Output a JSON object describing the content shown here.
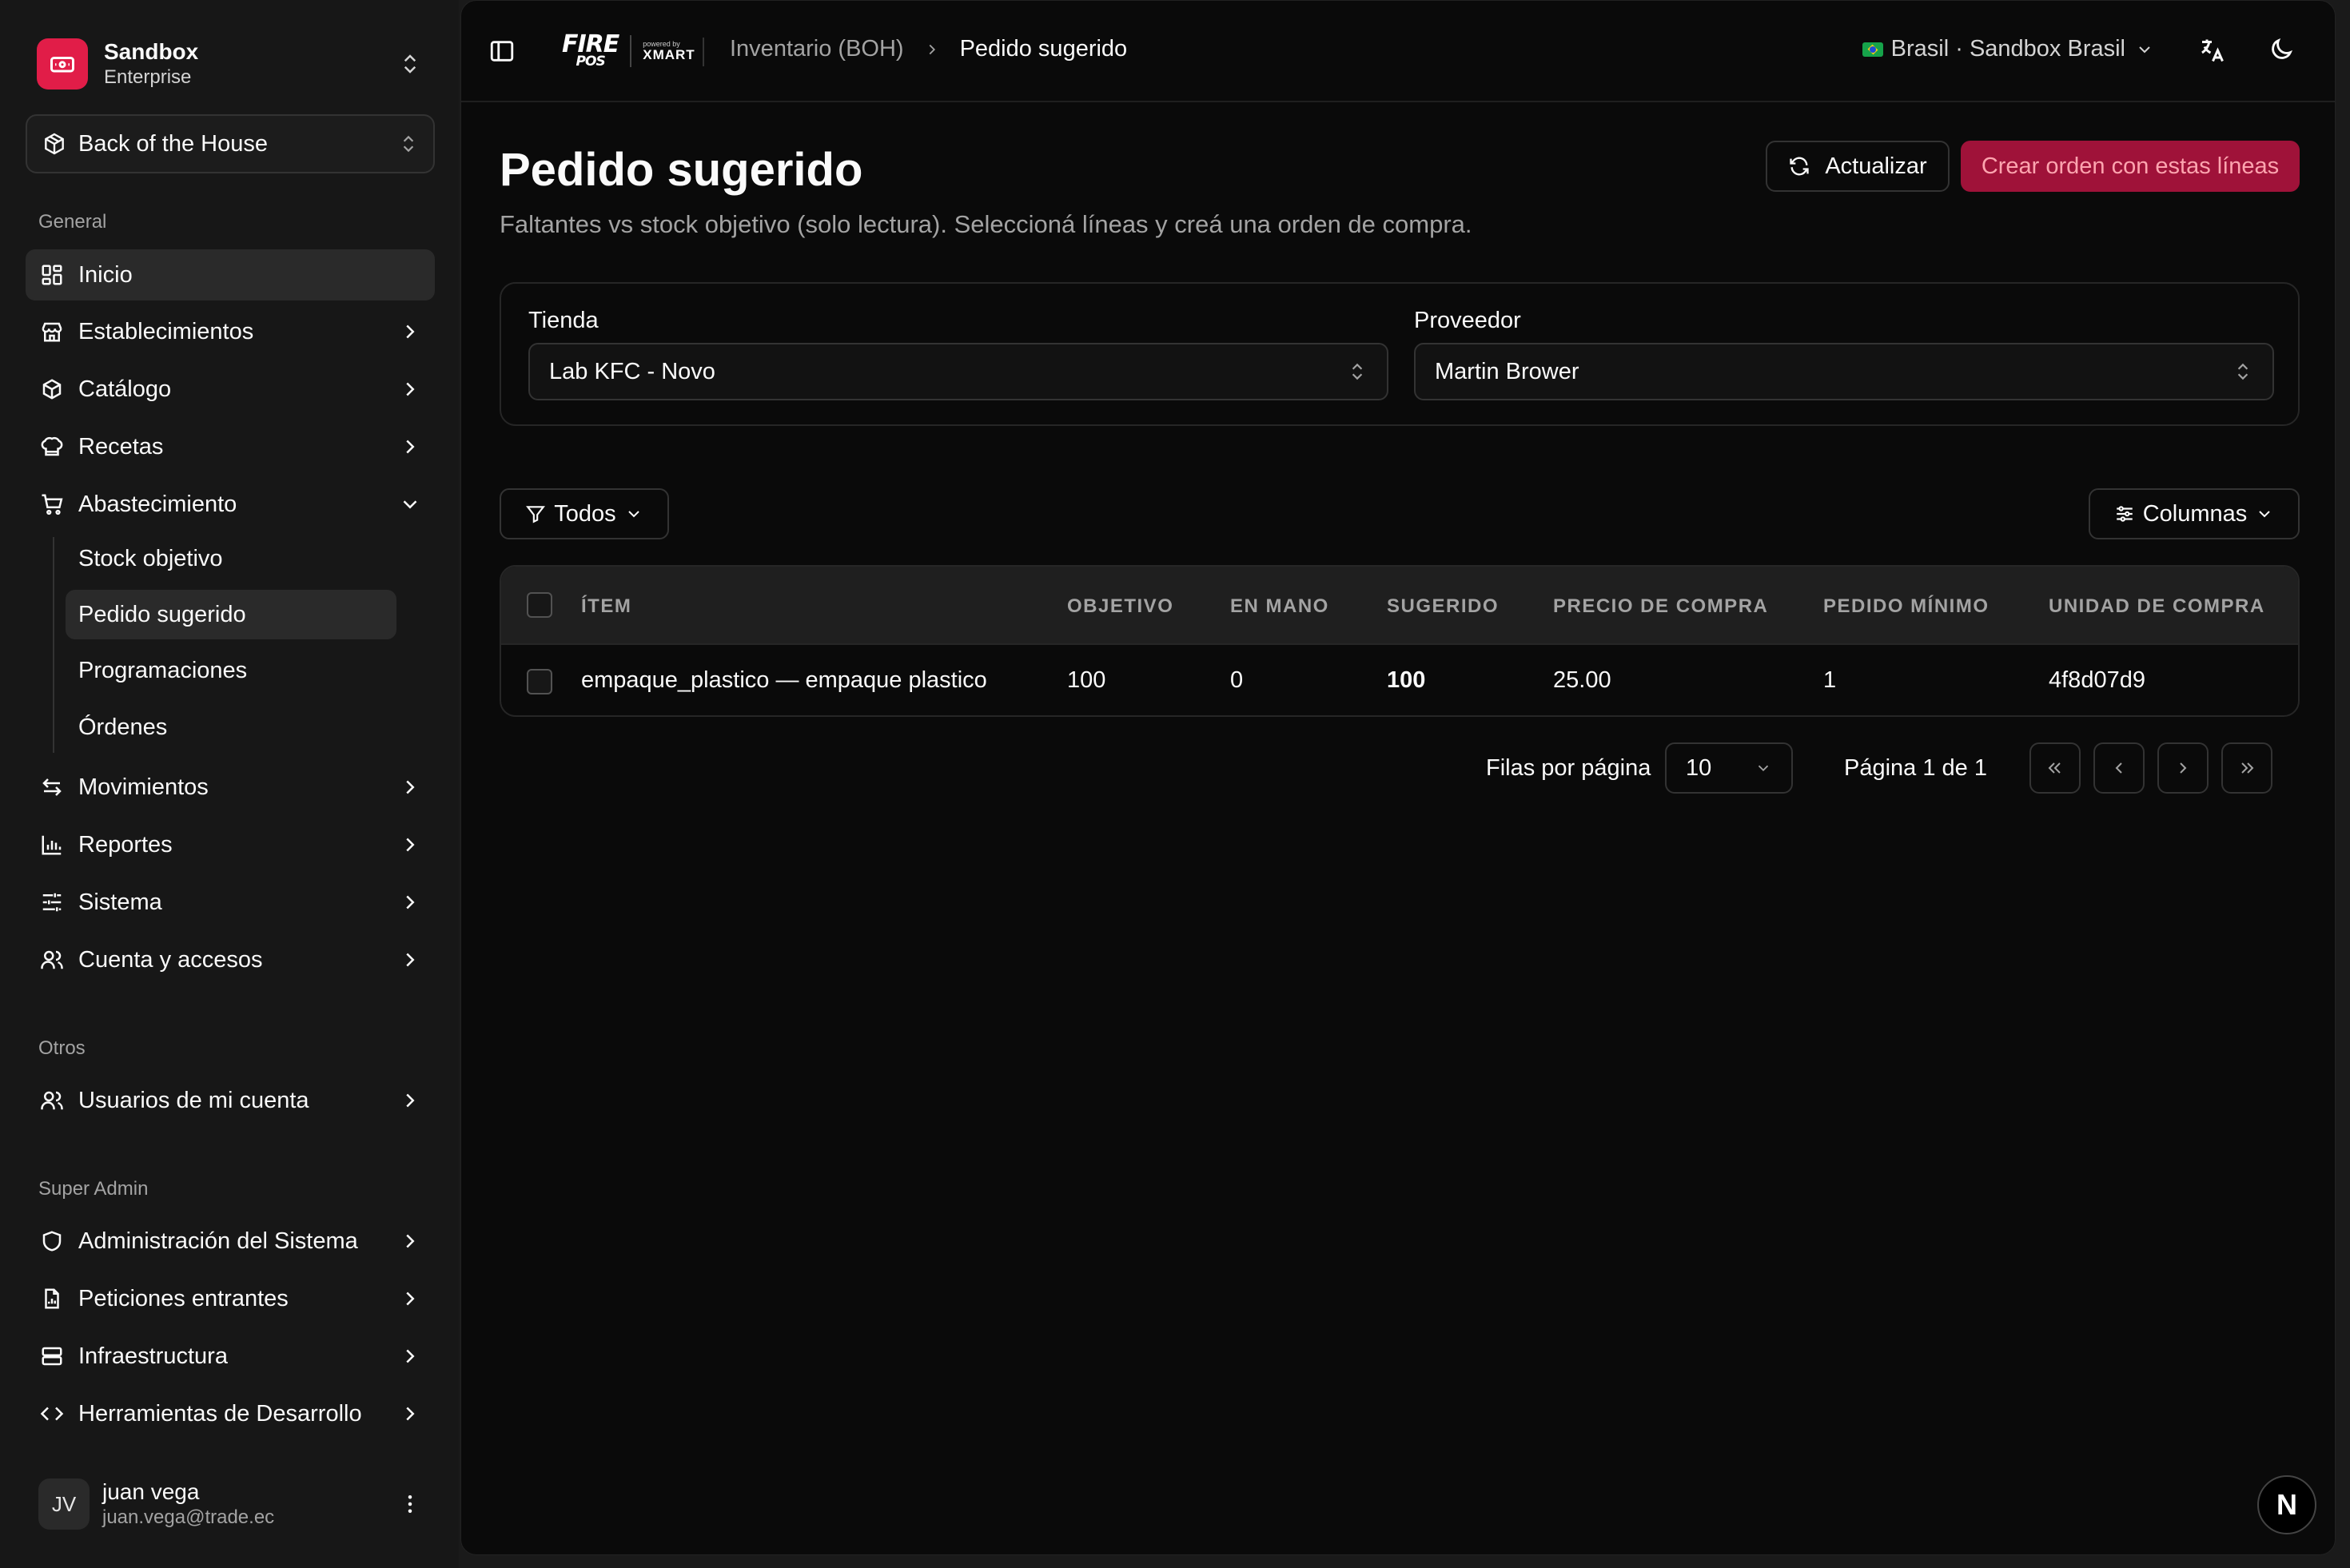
{
  "org": {
    "name": "Sandbox",
    "plan": "Enterprise"
  },
  "context": {
    "label": "Back of the House"
  },
  "sidebar": {
    "section_general": "General",
    "items": [
      {
        "label": "Inicio",
        "icon": "dashboard-icon"
      },
      {
        "label": "Establecimientos",
        "icon": "store-icon"
      },
      {
        "label": "Catálogo",
        "icon": "package-icon"
      },
      {
        "label": "Recetas",
        "icon": "chef-hat-icon"
      },
      {
        "label": "Abastecimiento",
        "icon": "cart-icon"
      },
      {
        "label": "Movimientos",
        "icon": "arrows-icon"
      },
      {
        "label": "Reportes",
        "icon": "bar-chart-icon"
      },
      {
        "label": "Sistema",
        "icon": "sliders-icon"
      },
      {
        "label": "Cuenta y accesos",
        "icon": "users-icon"
      }
    ],
    "sub_items": [
      {
        "label": "Stock objetivo"
      },
      {
        "label": "Pedido sugerido"
      },
      {
        "label": "Programaciones"
      },
      {
        "label": "Órdenes"
      }
    ],
    "section_otros": "Otros",
    "otros_items": [
      {
        "label": "Usuarios de mi cuenta",
        "icon": "users-icon"
      }
    ],
    "section_superadmin": "Super Admin",
    "superadmin_items": [
      {
        "label": "Administración del Sistema",
        "icon": "shield-icon"
      },
      {
        "label": "Peticiones entrantes",
        "icon": "file-chart-icon"
      },
      {
        "label": "Infraestructura",
        "icon": "server-icon"
      },
      {
        "label": "Herramientas de Desarrollo",
        "icon": "code-icon"
      }
    ]
  },
  "user": {
    "initials": "JV",
    "name": "juan vega",
    "email": "juan.vega@trade.ec"
  },
  "topbar": {
    "brand_fire": "FIRE",
    "brand_pos": "POS",
    "brand_powered": "powered by",
    "brand_xmart": "XMART",
    "breadcrumb_parent": "Inventario (BOH)",
    "breadcrumb_current": "Pedido sugerido",
    "region": "Brasil · Sandbox Brasil"
  },
  "page": {
    "title": "Pedido sugerido",
    "subtitle": "Faltantes vs stock objetivo (solo lectura). Seleccioná líneas y creá una orden de compra.",
    "refresh_label": "Actualizar",
    "create_label": "Crear orden con estas líneas"
  },
  "filters": {
    "store_label": "Tienda",
    "store_value": "Lab KFC - Novo",
    "supplier_label": "Proveedor",
    "supplier_value": "Martin Brower"
  },
  "toolbar": {
    "filter_label": "Todos",
    "columns_label": "Columnas"
  },
  "table": {
    "headers": [
      "ÍTEM",
      "OBJETIVO",
      "EN MANO",
      "SUGERIDO",
      "PRECIO DE COMPRA",
      "PEDIDO MÍNIMO",
      "UNIDAD DE COMPRA"
    ],
    "rows": [
      {
        "item": "empaque_plastico — empaque plastico",
        "objetivo": "100",
        "en_mano": "0",
        "sugerido": "100",
        "precio": "25.00",
        "pedido_minimo": "1",
        "unidad": "4f8d07d9"
      }
    ]
  },
  "pagination": {
    "rows_label": "Filas por página",
    "rows_value": "10",
    "page_info": "Página 1 de 1"
  },
  "badge": {
    "label": "N"
  },
  "colors": {
    "accent": "#e11d48",
    "create_button": "#9f1239",
    "background": "#0a0a0a",
    "sidebar": "#171717"
  }
}
